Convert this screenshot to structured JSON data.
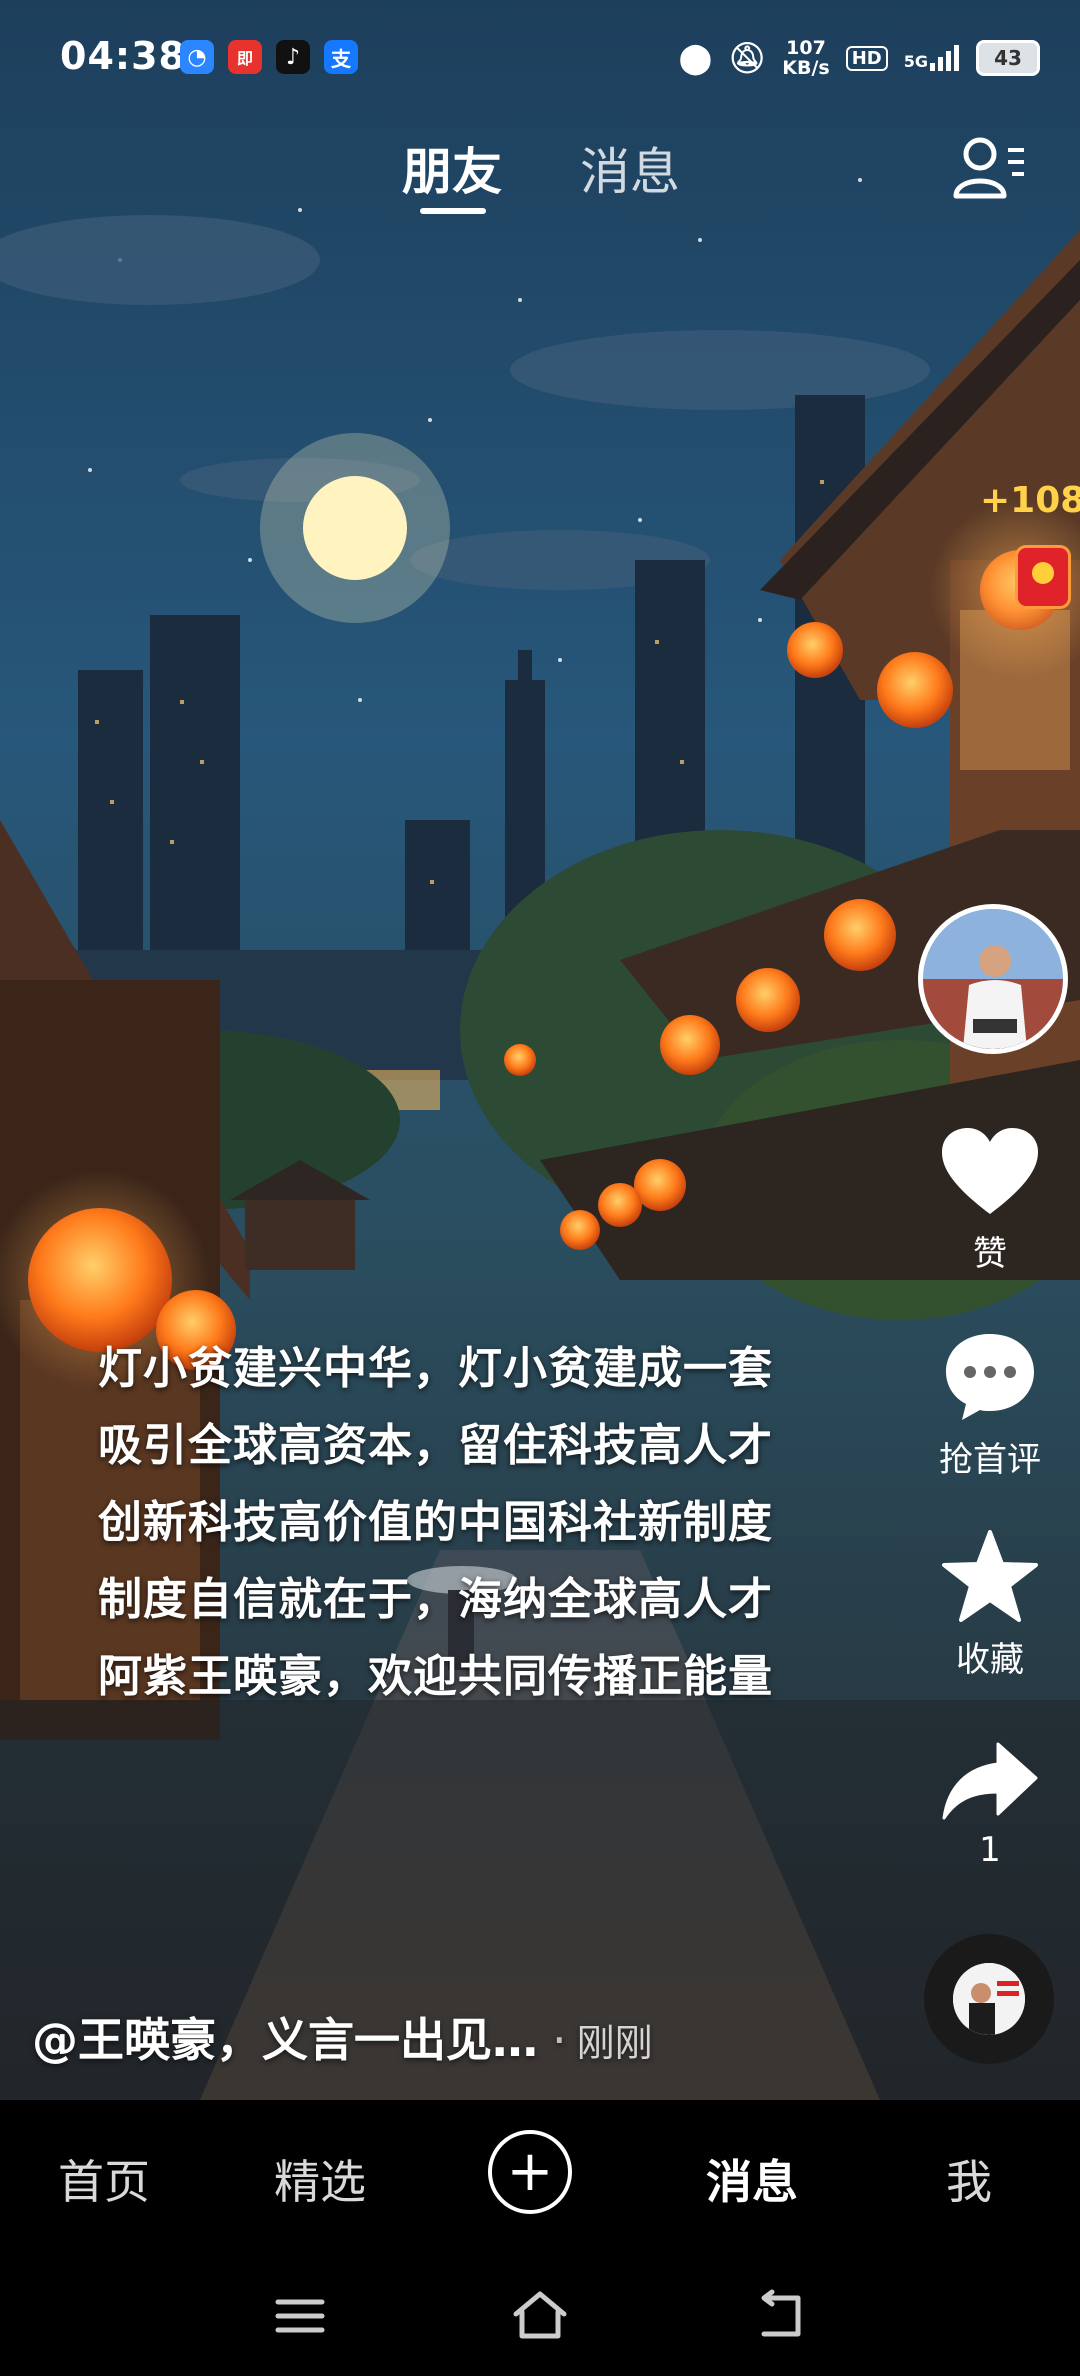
{
  "status_bar": {
    "time": "04:38",
    "net_speed_value": "107",
    "net_speed_unit": "KB/s",
    "hd_label": "HD",
    "network_label": "5G",
    "battery": "43",
    "app_icons": [
      "browser-icon",
      "news-app-icon",
      "tiktok-icon",
      "alipay-icon"
    ]
  },
  "top_tabs": {
    "friends": "朋友",
    "messages": "消息"
  },
  "right_rail": {
    "bonus": "+108",
    "like_label": "赞",
    "comment_label": "抢首评",
    "favorite_label": "收藏",
    "share_count": "1"
  },
  "caption": {
    "lines": [
      "灯小贫建兴中华，灯小贫建成一套",
      "吸引全球高资本，留住科技高人才",
      "创新科技高价值的中国科社新制度",
      "制度自信就在于，海纳全球高人才",
      "阿紫王暎豪，欢迎共同传播正能量"
    ]
  },
  "author": {
    "text": "@王暎豪，义言一出见…",
    "separator": "·",
    "time": "刚刚"
  },
  "bottom_nav": {
    "home": "首页",
    "featured": "精选",
    "create": "+",
    "messages": "消息",
    "me": "我"
  },
  "colors": {
    "bonus": "#ffd24a",
    "red_packet": "#e0232b",
    "sky_top": "#1d3f5c",
    "lantern": "#ff7a1a"
  }
}
